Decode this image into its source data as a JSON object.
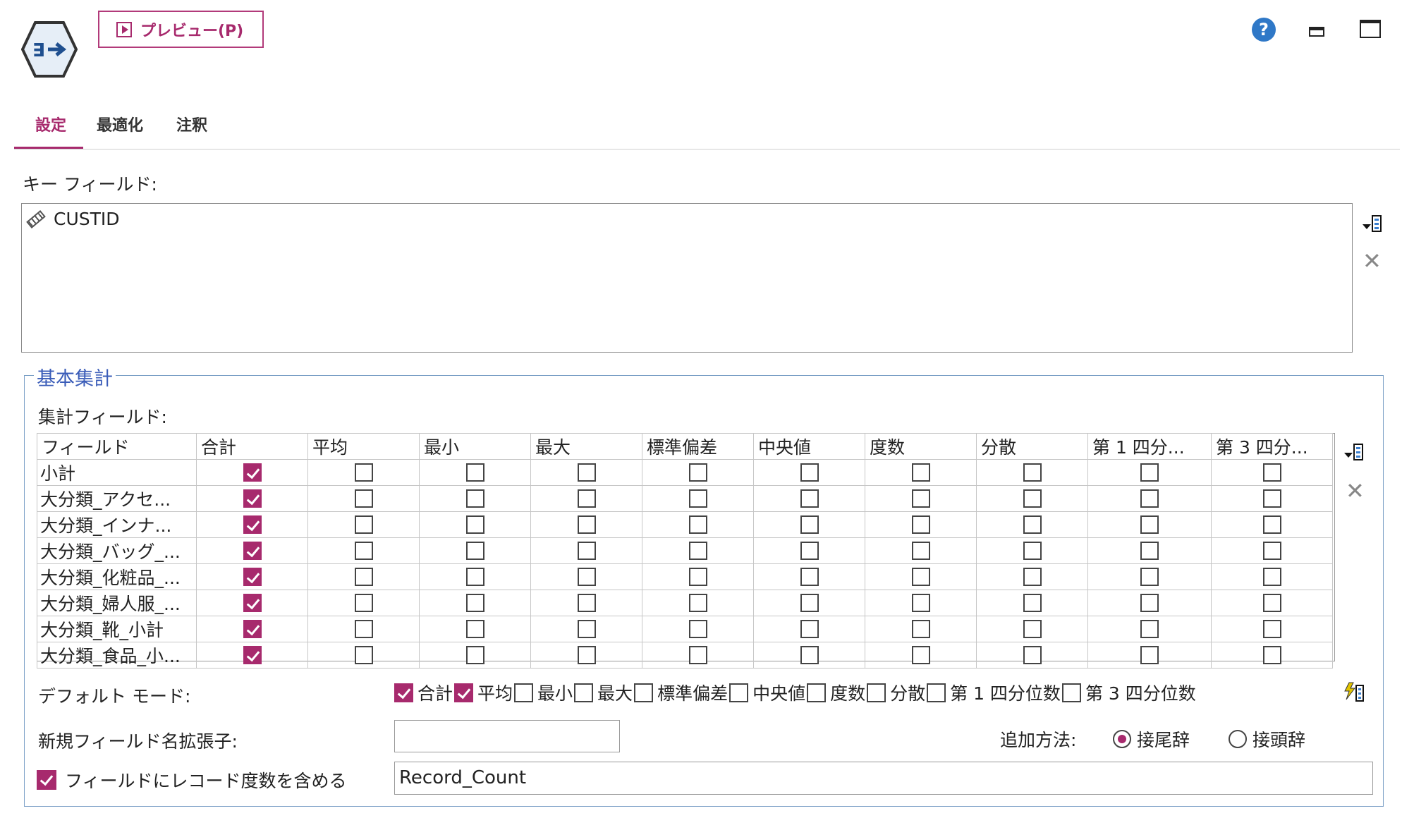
{
  "header": {
    "preview_label": "プレビュー(P)",
    "help_glyph": "?"
  },
  "tabs": [
    {
      "label": "設定",
      "active": true
    },
    {
      "label": "最適化",
      "active": false
    },
    {
      "label": "注釈",
      "active": false
    }
  ],
  "key_fields": {
    "label": "キー フィールド:",
    "items": [
      "CUSTID"
    ]
  },
  "basic_aggregates": {
    "title": "基本集計",
    "agg_fields_label": "集計フィールド:",
    "columns": [
      "フィールド",
      "合計",
      "平均",
      "最小",
      "最大",
      "標準偏差",
      "中央値",
      "度数",
      "分散",
      "第 1 四分...",
      "第 3 四分..."
    ],
    "rows": [
      {
        "name": "小計",
        "checks": [
          true,
          false,
          false,
          false,
          false,
          false,
          false,
          false,
          false,
          false
        ]
      },
      {
        "name": "大分類_アクセ...",
        "checks": [
          true,
          false,
          false,
          false,
          false,
          false,
          false,
          false,
          false,
          false
        ]
      },
      {
        "name": "大分類_インナ...",
        "checks": [
          true,
          false,
          false,
          false,
          false,
          false,
          false,
          false,
          false,
          false
        ]
      },
      {
        "name": "大分類_バッグ_...",
        "checks": [
          true,
          false,
          false,
          false,
          false,
          false,
          false,
          false,
          false,
          false
        ]
      },
      {
        "name": "大分類_化粧品_...",
        "checks": [
          true,
          false,
          false,
          false,
          false,
          false,
          false,
          false,
          false,
          false
        ]
      },
      {
        "name": "大分類_婦人服_...",
        "checks": [
          true,
          false,
          false,
          false,
          false,
          false,
          false,
          false,
          false,
          false
        ]
      },
      {
        "name": "大分類_靴_小計",
        "checks": [
          true,
          false,
          false,
          false,
          false,
          false,
          false,
          false,
          false,
          false
        ]
      },
      {
        "name": "大分類_食品_小...",
        "checks": [
          true,
          false,
          false,
          false,
          false,
          false,
          false,
          false,
          false,
          false
        ]
      }
    ],
    "default_mode_label": "デフォルト モード:",
    "default_modes": [
      {
        "label": "合計",
        "checked": true
      },
      {
        "label": "平均",
        "checked": true
      },
      {
        "label": "最小",
        "checked": false
      },
      {
        "label": "最大",
        "checked": false
      },
      {
        "label": "標準偏差",
        "checked": false
      },
      {
        "label": "中央値",
        "checked": false
      },
      {
        "label": "度数",
        "checked": false
      },
      {
        "label": "分散",
        "checked": false
      },
      {
        "label": "第 1 四分位数",
        "checked": false
      },
      {
        "label": "第 3 四分位数",
        "checked": false
      }
    ],
    "new_field_suffix_label": "新規フィールド名拡張子:",
    "new_field_suffix_value": "",
    "add_method_label": "追加方法:",
    "add_method_options": [
      {
        "label": "接尾辞",
        "selected": true
      },
      {
        "label": "接頭辞",
        "selected": false
      }
    ],
    "include_record_count_label": "フィールドにレコード度数を含める",
    "include_record_count_checked": true,
    "record_count_field": "Record_Count"
  },
  "colors": {
    "accent": "#a72a6d",
    "group_title": "#3a5cb8",
    "help": "#2f78c7"
  }
}
